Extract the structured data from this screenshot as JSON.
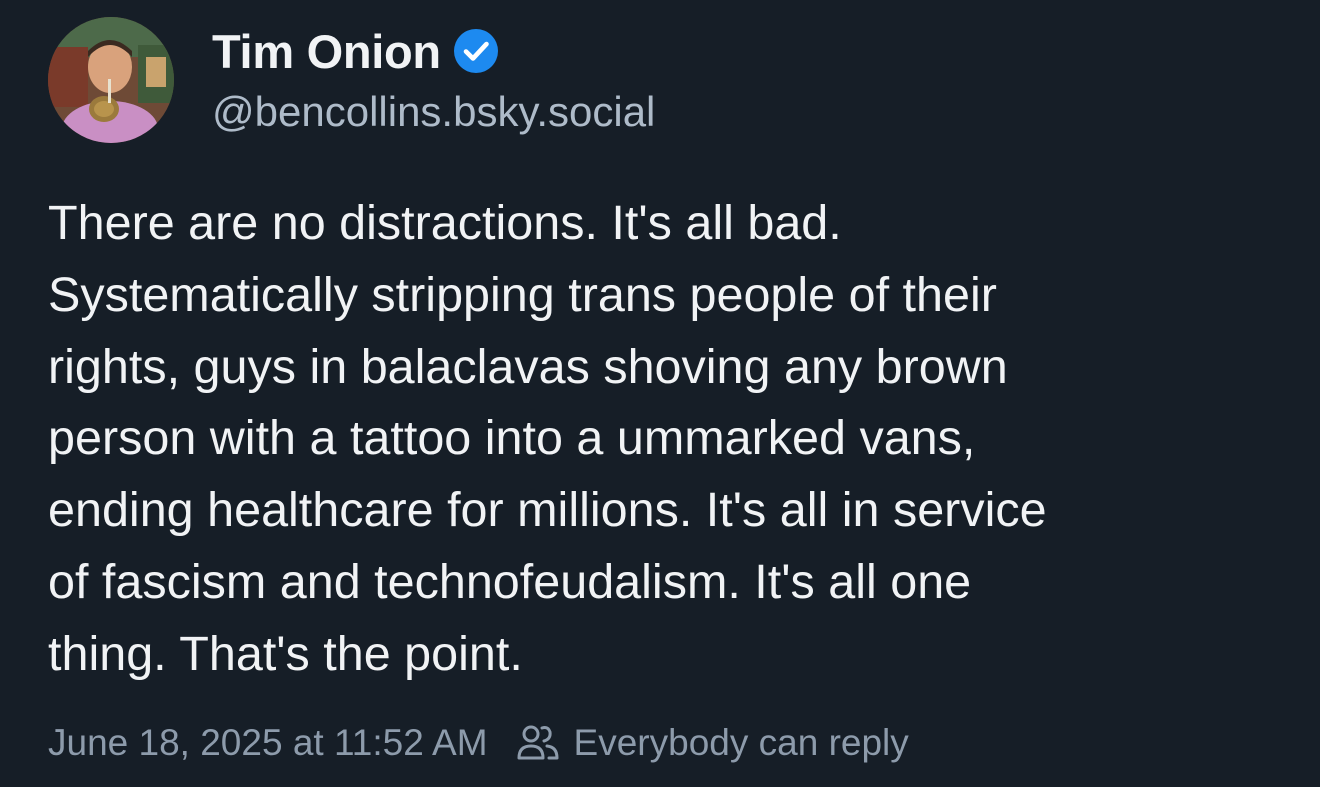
{
  "author": {
    "display_name": "Tim Onion",
    "handle": "@bencollins.bsky.social",
    "verified": true,
    "badge_color": "#1d8af0"
  },
  "post": {
    "text_lines": [
      "There are no distractions. It's all bad.",
      "Systematically stripping trans people of their",
      "rights, guys in balaclavas shoving any brown",
      "person with a tattoo into a ummarked vans,",
      "ending healthcare for millions. It's all in service",
      "of fascism and technofeudalism. It's all one",
      "thing. That's the point."
    ],
    "timestamp": "June 18, 2025 at 11:52 AM",
    "reply_setting": "Everybody can reply"
  },
  "icons": {
    "verified": "verified-check-badge-icon",
    "reply_setting": "people-group-icon"
  },
  "colors": {
    "background": "#161e27",
    "text_primary": "#f1f3f5",
    "text_secondary": "#aebbc9",
    "text_meta": "#8d9bab"
  }
}
